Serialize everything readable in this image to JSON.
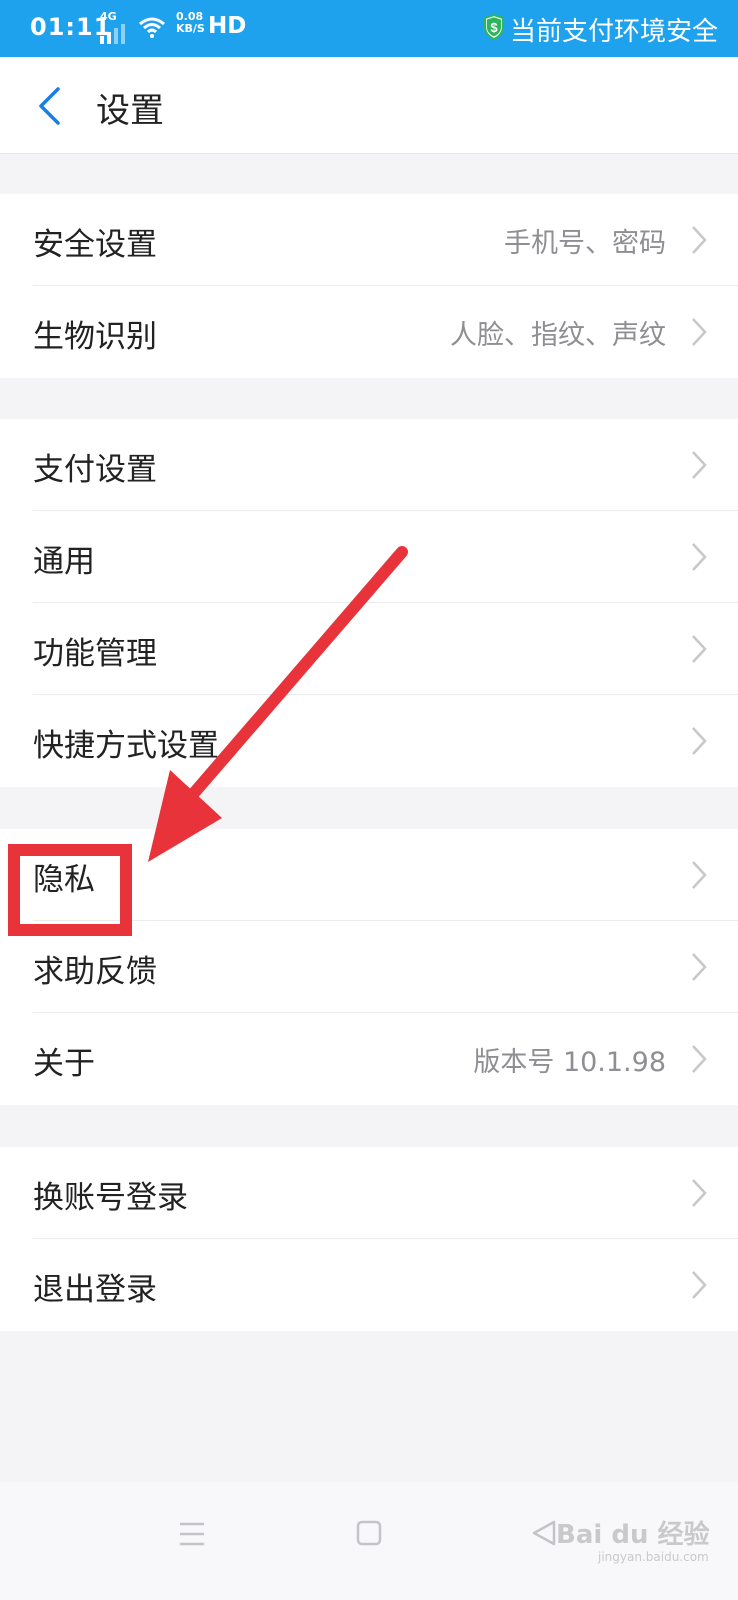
{
  "status_bar": {
    "time": "01:11",
    "network": "4G",
    "speed_value": "0.08",
    "speed_unit": "KB/S",
    "hd": "HD",
    "security_text": "当前支付环境安全",
    "background_color": "#1fa2ee"
  },
  "header": {
    "back_icon": "chevron-left-icon",
    "title": "设置",
    "accent_color": "#1a7ee6"
  },
  "groups": [
    {
      "items": [
        {
          "label": "安全设置",
          "sub": "手机号、密码"
        },
        {
          "label": "生物识别",
          "sub": "人脸、指纹、声纹"
        }
      ]
    },
    {
      "items": [
        {
          "label": "支付设置",
          "sub": ""
        },
        {
          "label": "通用",
          "sub": ""
        },
        {
          "label": "功能管理",
          "sub": ""
        },
        {
          "label": "快捷方式设置",
          "sub": ""
        }
      ]
    },
    {
      "items": [
        {
          "label": "隐私",
          "sub": ""
        },
        {
          "label": "求助反馈",
          "sub": ""
        },
        {
          "label": "关于",
          "sub": "版本号 10.1.98"
        }
      ]
    },
    {
      "items": [
        {
          "label": "换账号登录",
          "sub": ""
        },
        {
          "label": "退出登录",
          "sub": ""
        }
      ]
    }
  ],
  "annotation": {
    "color": "#e8333a",
    "highlighted_item": "隐私"
  },
  "nav_bar": {
    "buttons": [
      "menu-icon",
      "home-square-icon",
      "back-triangle-icon"
    ]
  },
  "watermark": {
    "text": "Bai du 经验",
    "sub": "jingyan.baidu.com"
  }
}
